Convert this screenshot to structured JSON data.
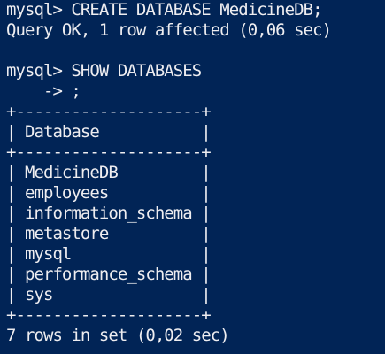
{
  "terminal": {
    "lines": [
      "mysql> CREATE DATABASE MedicineDB;",
      "Query OK, 1 row affected (0,06 sec)",
      "",
      "mysql> SHOW DATABASES",
      "    -> ;",
      "+--------------------+",
      "| Database           |",
      "+--------------------+",
      "| MedicineDB         |",
      "| employees          |",
      "| information_schema |",
      "| metastore          |",
      "| mysql              |",
      "| performance_schema |",
      "| sys                |",
      "+--------------------+",
      "7 rows in set (0,02 sec)"
    ]
  }
}
